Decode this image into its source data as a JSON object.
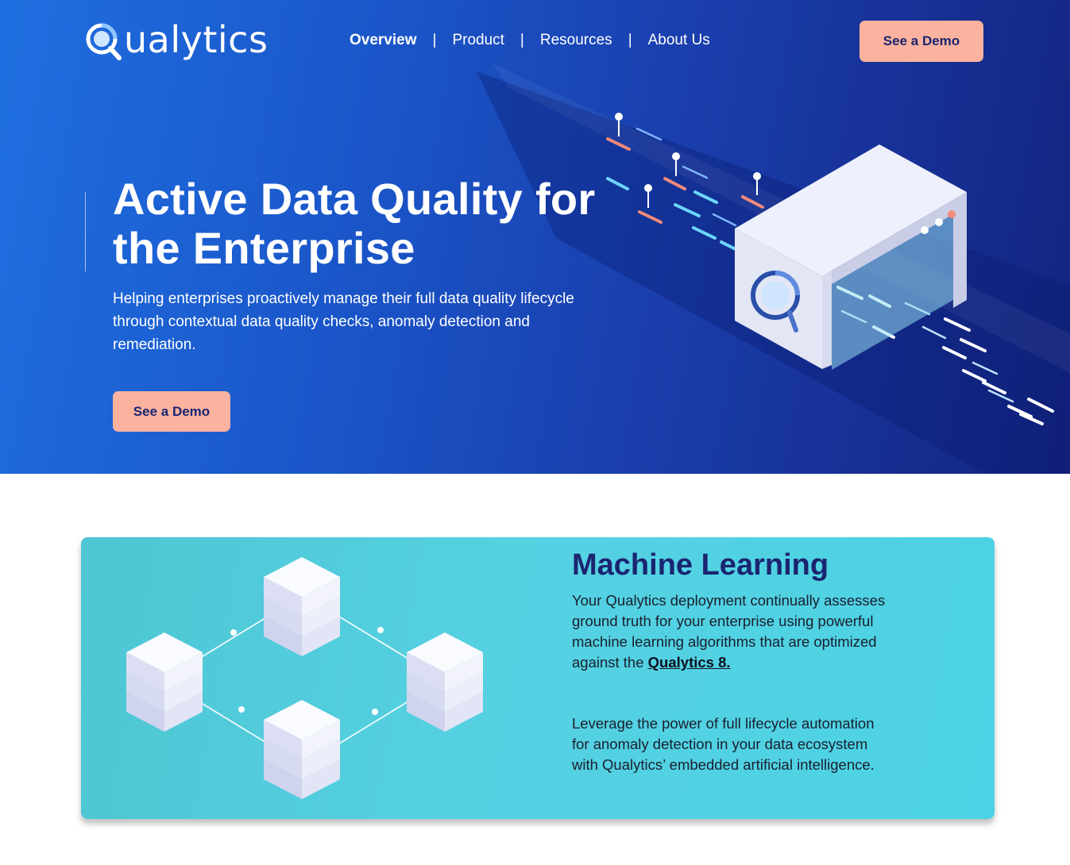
{
  "header": {
    "logo_text": "ualytics",
    "logo_icon": "magnifier-q-icon",
    "nav": [
      {
        "label": "Overview",
        "active": true
      },
      {
        "label": "Product",
        "active": false
      },
      {
        "label": "Resources",
        "active": false
      },
      {
        "label": "About Us",
        "active": false
      }
    ],
    "separator": "|",
    "cta_label": "See a Demo"
  },
  "hero": {
    "title": "Active Data Quality for the Enterprise",
    "subtitle": "Helping enterprises proactively manage their full data quality lifecycle through contextual data quality checks, anomaly detection and remediation.",
    "cta_label": "See a Demo"
  },
  "feature": {
    "title": "Machine Learning",
    "paragraph1_text": "Your Qualytics deployment continually assesses ground truth for your enterprise using powerful machine learning algorithms that are optimized against the",
    "paragraph1_link": "Qualytics 8.",
    "paragraph2": "Leverage the power of full lifecycle automation for anomaly detection in your data ecosystem with Qualytics’ embedded artificial intelligence."
  },
  "colors": {
    "hero_gradient_start": "#1f6fe0",
    "hero_gradient_end": "#14237f",
    "cta_background": "#fbb39f",
    "cta_text": "#1b2470",
    "card_background": "#4ec6d3",
    "card_title": "#1b2470"
  }
}
